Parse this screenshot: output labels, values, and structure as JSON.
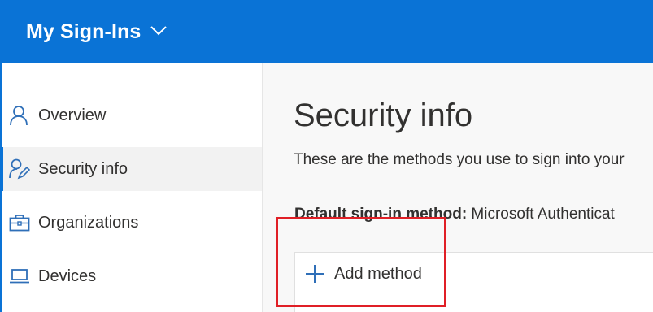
{
  "header": {
    "app_title": "My Sign-Ins",
    "title_dropdown_icon": "chevron-down-icon"
  },
  "sidebar": {
    "items": [
      {
        "label": "Overview",
        "icon": "person-icon",
        "active": false
      },
      {
        "label": "Security info",
        "icon": "person-edit-icon",
        "active": true
      },
      {
        "label": "Organizations",
        "icon": "briefcase-icon",
        "active": false
      },
      {
        "label": "Devices",
        "icon": "laptop-icon",
        "active": false
      }
    ]
  },
  "main": {
    "title": "Security info",
    "description": "These are the methods you use to sign into your",
    "default_method_label": "Default sign-in method:",
    "default_method_value": " Microsoft Authenticat",
    "add_method_label": "Add method",
    "add_method_icon": "plus-icon"
  },
  "colors": {
    "brand": "#0a73d6",
    "highlight": "#e01f26",
    "content_bg": "#f8f8f8",
    "active_item_bg": "#f2f2f2"
  }
}
